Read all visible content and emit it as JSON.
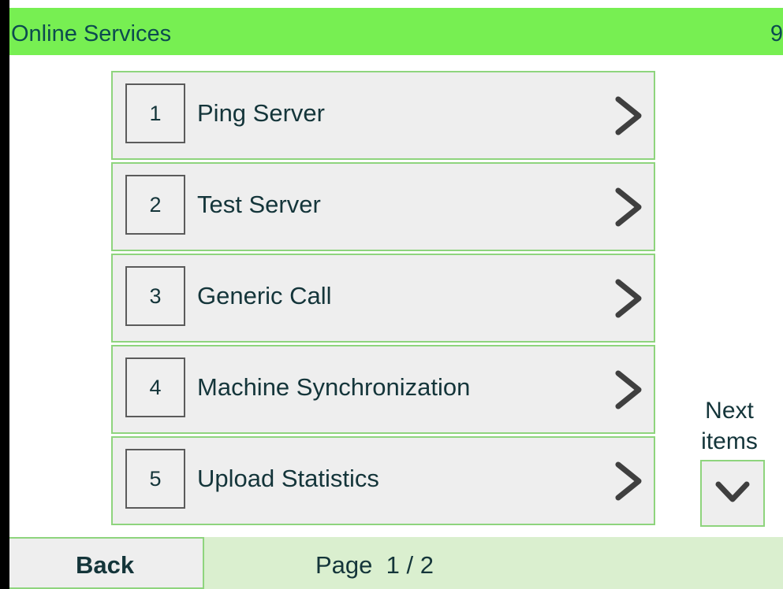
{
  "header": {
    "title": "Online Services",
    "code": "9"
  },
  "menu": {
    "items": [
      {
        "number": "1",
        "label": "Ping Server",
        "icon": "chevron-right-icon"
      },
      {
        "number": "2",
        "label": "Test Server",
        "icon": "chevron-right-icon"
      },
      {
        "number": "3",
        "label": "Generic Call",
        "icon": "chevron-right-icon"
      },
      {
        "number": "4",
        "label": "Machine Synchronization",
        "icon": "chevron-right-icon"
      },
      {
        "number": "5",
        "label": "Upload Statistics",
        "icon": "chevron-right-icon"
      }
    ]
  },
  "navigation": {
    "next_items_label_line1": "Next",
    "next_items_label_line2": "items",
    "next_items_icon": "chevron-down-icon"
  },
  "footer": {
    "back_label": "Back",
    "page_label": "Page",
    "page_value": "1 / 2"
  },
  "colors": {
    "header_background": "#77ef52",
    "footer_background": "#daefcf",
    "item_border": "#8ed47d",
    "text": "#14353a"
  }
}
